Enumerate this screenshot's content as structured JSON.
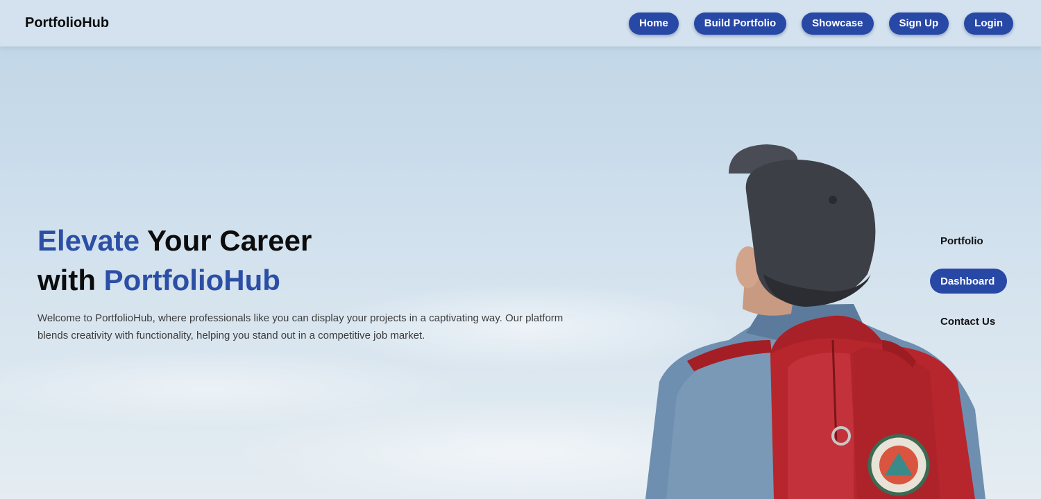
{
  "header": {
    "logo": "PortfolioHub",
    "nav": [
      {
        "label": "Home"
      },
      {
        "label": "Build Portfolio"
      },
      {
        "label": "Showcase"
      },
      {
        "label": "Sign Up"
      },
      {
        "label": "Login"
      }
    ]
  },
  "hero": {
    "title_part1": "Elevate",
    "title_part2": " Your Career",
    "title_part3": "with ",
    "title_part4": "PortfolioHub",
    "description": "Welcome to PortfolioHub, where professionals like you can display your projects in a captivating way. Our platform blends creativity with functionality, helping you stand out in a competitive job market."
  },
  "side_nav": {
    "items": [
      {
        "label": "Portfolio",
        "active": false
      },
      {
        "label": "Dashboard",
        "active": true
      },
      {
        "label": "Contact Us",
        "active": false
      }
    ]
  },
  "colors": {
    "accent": "#2c4fa5",
    "button": "#2848a6",
    "backpack": "#b7262c"
  }
}
